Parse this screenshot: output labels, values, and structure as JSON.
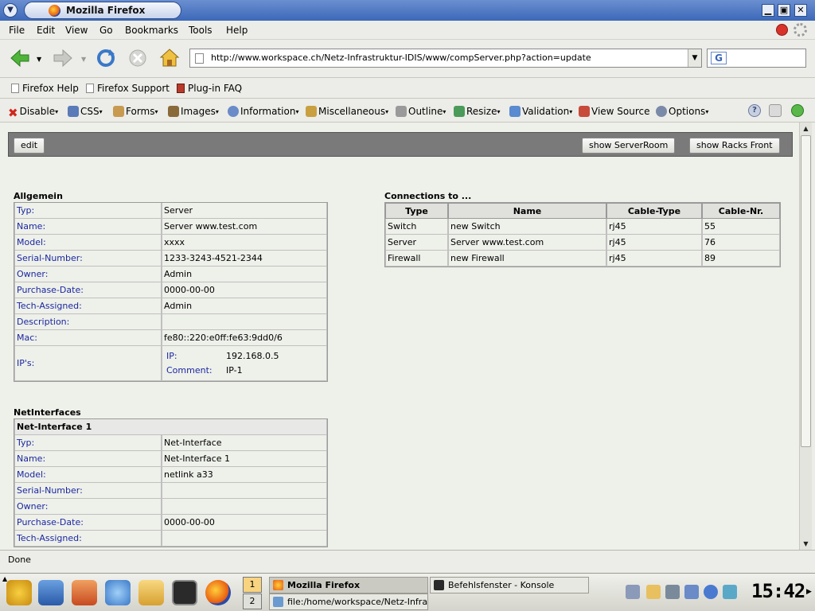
{
  "window": {
    "title": "Mozilla Firefox",
    "buttons": {
      "minimize": "▁",
      "maximize": "▣",
      "close": "✕"
    },
    "menu_knob": "▼"
  },
  "menubar": {
    "items": [
      {
        "label": "File"
      },
      {
        "label": "Edit"
      },
      {
        "label": "View"
      },
      {
        "label": "Go"
      },
      {
        "label": "Bookmarks"
      },
      {
        "label": "Tools"
      },
      {
        "label": "Help"
      }
    ]
  },
  "navbar": {
    "url": "http://www.workspace.ch/Netz-Infrastruktur-IDIS/www/compServer.php?action=update",
    "url_dropdown": "▼",
    "search_engine": "G"
  },
  "bookmarks": [
    {
      "label": "Firefox Help"
    },
    {
      "label": "Firefox Support"
    },
    {
      "label": "Plug-in FAQ"
    }
  ],
  "webdev": {
    "items": [
      {
        "label": "Disable",
        "icon": "x-icon"
      },
      {
        "label": "CSS",
        "icon": "css-icon"
      },
      {
        "label": "Forms",
        "icon": "forms-icon"
      },
      {
        "label": "Images",
        "icon": "images-icon"
      },
      {
        "label": "Information",
        "icon": "info-icon"
      },
      {
        "label": "Miscellaneous",
        "icon": "misc-icon"
      },
      {
        "label": "Outline",
        "icon": "outline-icon"
      },
      {
        "label": "Resize",
        "icon": "resize-icon"
      },
      {
        "label": "Validation",
        "icon": "validation-icon"
      },
      {
        "label": "View Source",
        "icon": "source-icon"
      },
      {
        "label": "Options",
        "icon": "options-icon"
      }
    ],
    "caret": "▾"
  },
  "actions": {
    "edit": "edit",
    "show_serverroom": "show ServerRoom",
    "show_racks_front": "show Racks Front"
  },
  "allgemein": {
    "title": "Allgemein",
    "rows": [
      {
        "key": "Typ:",
        "value": "Server"
      },
      {
        "key": "Name:",
        "value": "Server www.test.com"
      },
      {
        "key": "Model:",
        "value": "xxxx"
      },
      {
        "key": "Serial-Number:",
        "value": "1233-3243-4521-2344"
      },
      {
        "key": "Owner:",
        "value": "Admin"
      },
      {
        "key": "Purchase-Date:",
        "value": "0000-00-00"
      },
      {
        "key": "Tech-Assigned:",
        "value": "Admin"
      },
      {
        "key": "Description:",
        "value": ""
      },
      {
        "key": "Mac:",
        "value": "fe80::220:e0ff:fe63:9dd0/6"
      }
    ],
    "ips": {
      "key": "IP's:",
      "ip_label": "IP:",
      "ip_value": "192.168.0.5",
      "comment_label": "Comment:",
      "comment_value": "IP-1"
    }
  },
  "connections": {
    "title": "Connections to ...",
    "headers": [
      "Type",
      "Name",
      "Cable-Type",
      "Cable-Nr."
    ],
    "rows": [
      [
        "Switch",
        "new Switch",
        "rj45",
        "55"
      ],
      [
        "Server",
        "Server www.test.com",
        "rj45",
        "76"
      ],
      [
        "Firewall",
        "new Firewall",
        "rj45",
        "89"
      ]
    ]
  },
  "netinterfaces": {
    "title": "NetInterfaces",
    "header": "Net-Interface 1",
    "rows": [
      {
        "key": "Typ:",
        "value": "Net-Interface"
      },
      {
        "key": "Name:",
        "value": "Net-Interface 1"
      },
      {
        "key": "Model:",
        "value": "netlink a33"
      },
      {
        "key": "Serial-Number:",
        "value": ""
      },
      {
        "key": "Owner:",
        "value": ""
      },
      {
        "key": "Purchase-Date:",
        "value": "0000-00-00"
      },
      {
        "key": "Tech-Assigned:",
        "value": ""
      }
    ]
  },
  "status": "Done",
  "taskbar": {
    "pager": [
      "1",
      "2"
    ],
    "tasks": [
      {
        "label": "Mozilla Firefox"
      },
      {
        "label": "Befehlsfenster - Konsole"
      },
      {
        "label": "file:/home/workspace/Netz-Infrastrukt"
      }
    ],
    "clock": "15:42",
    "scroll_arrow": "▶"
  },
  "scrollbar": {
    "up": "▲",
    "down": "▼"
  }
}
